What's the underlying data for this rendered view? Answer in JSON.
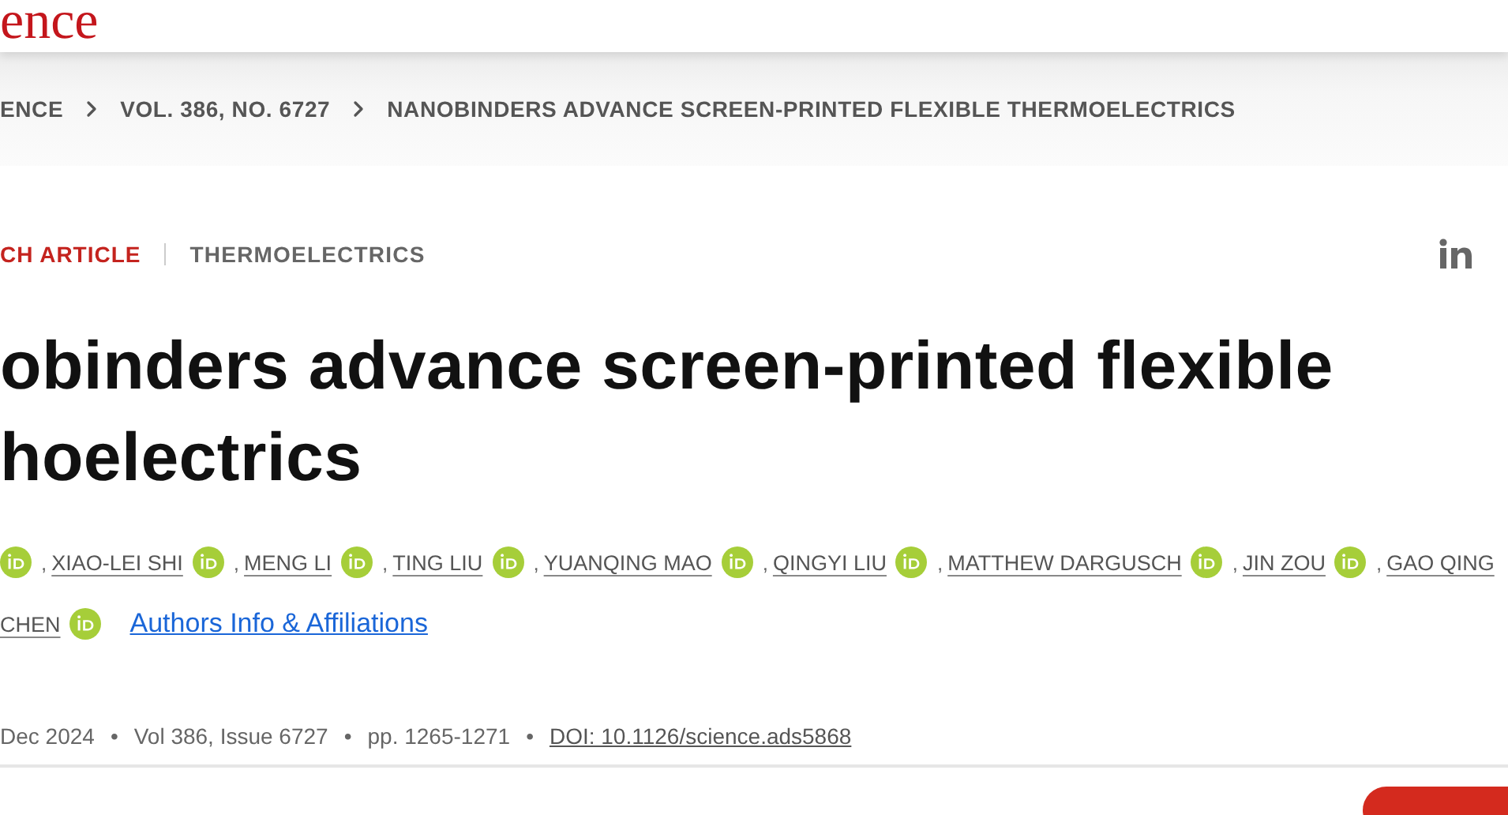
{
  "logo": {
    "text": "ence"
  },
  "breadcrumbs": [
    "ENCE",
    "VOL. 386, NO. 6727",
    "NANOBINDERS ADVANCE SCREEN-PRINTED FLEXIBLE THERMOELECTRICS"
  ],
  "article_type": "CH ARTICLE",
  "topic": "THERMOELECTRICS",
  "title_lines": [
    "obinders advance screen-printed flexible",
    "hoelectrics"
  ],
  "author_rows": [
    [
      {
        "kind": "orcid"
      },
      {
        "kind": "name",
        "prefix": ",",
        "text": "XIAO-LEI SHI"
      },
      {
        "kind": "orcid"
      },
      {
        "kind": "name",
        "prefix": ",",
        "text": "MENG LI"
      },
      {
        "kind": "orcid"
      },
      {
        "kind": "name",
        "prefix": ",",
        "text": "TING LIU"
      },
      {
        "kind": "orcid"
      },
      {
        "kind": "name",
        "prefix": ",",
        "text": "YUANQING MAO"
      },
      {
        "kind": "orcid"
      },
      {
        "kind": "name",
        "prefix": ",",
        "text": "QINGYI LIU"
      },
      {
        "kind": "orcid"
      },
      {
        "kind": "name",
        "prefix": ",",
        "text": "MATTHEW DARGUSCH"
      },
      {
        "kind": "orcid"
      },
      {
        "kind": "name",
        "prefix": ",",
        "text": "JIN ZOU"
      },
      {
        "kind": "orcid"
      },
      {
        "kind": "name",
        "prefix": ",",
        "text": "GAO QING"
      }
    ],
    [
      {
        "kind": "name",
        "text": "CHEN"
      },
      {
        "kind": "orcid"
      },
      {
        "kind": "link",
        "text": "Authors Info & Affiliations"
      }
    ]
  ],
  "meta": {
    "items": [
      "Dec 2024",
      "Vol 386, Issue 6727",
      "pp. 1265-1271"
    ],
    "separator": "•",
    "doi": "DOI: 10.1126/science.ads5868"
  }
}
